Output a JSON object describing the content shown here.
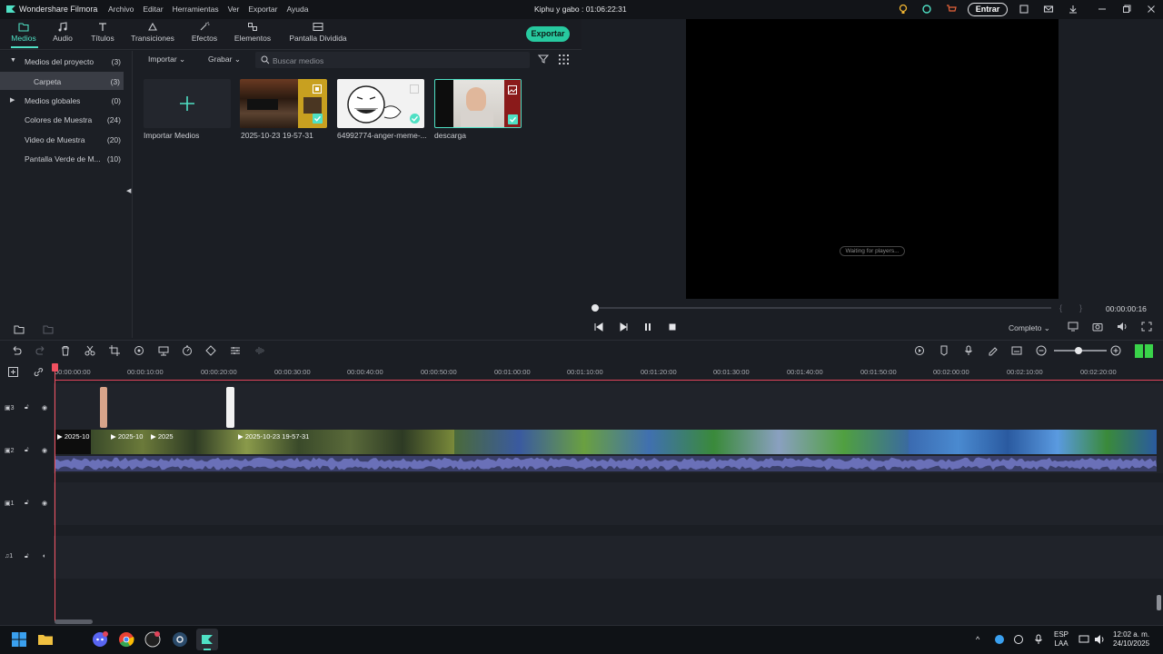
{
  "app": {
    "name": "Wondershare Filmora",
    "project_title": "Kiphu y gabo : 01:06:22:31",
    "login_label": "Entrar"
  },
  "menu": [
    "Archivo",
    "Editar",
    "Herramientas",
    "Ver",
    "Exportar",
    "Ayuda"
  ],
  "tabs": [
    {
      "label": "Medios",
      "icon": "folder-icon"
    },
    {
      "label": "Audio",
      "icon": "music-icon"
    },
    {
      "label": "Títulos",
      "icon": "text-icon"
    },
    {
      "label": "Transiciones",
      "icon": "transition-icon"
    },
    {
      "label": "Efectos",
      "icon": "effects-icon"
    },
    {
      "label": "Elementos",
      "icon": "elements-icon"
    },
    {
      "label": "Pantalla Dividida",
      "icon": "split-screen-icon"
    }
  ],
  "export_label": "Exportar",
  "sidebar": {
    "items": [
      {
        "label": "Medios del proyecto",
        "count": "(3)"
      },
      {
        "label": "Carpeta",
        "count": "(3)"
      },
      {
        "label": "Medios globales",
        "count": "(0)"
      },
      {
        "label": "Colores de Muestra",
        "count": "(24)"
      },
      {
        "label": "Video de Muestra",
        "count": "(20)"
      },
      {
        "label": "Pantalla Verde de M...",
        "count": "(10)"
      }
    ]
  },
  "media": {
    "import_dropdown": "Importar",
    "record_dropdown": "Grabar",
    "search_placeholder": "Buscar medios",
    "import_media_label": "Importar Medios",
    "items": [
      {
        "label": "2025-10-23 19-57-31"
      },
      {
        "label": "64992774-anger-meme-..."
      },
      {
        "label": "descarga"
      }
    ]
  },
  "preview": {
    "waiting_text": "Waiting for players...",
    "timecode": "00:00:00:16",
    "quality": "Completo",
    "progress": 0
  },
  "timeline": {
    "ruler_labels": [
      "00:00:00:00",
      "00:00:10:00",
      "00:00:20:00",
      "00:00:30:00",
      "00:00:40:00",
      "00:00:50:00",
      "00:01:00:00",
      "00:01:10:00",
      "00:01:20:00",
      "00:01:30:00",
      "00:01:40:00",
      "00:01:50:00",
      "00:02:00:00",
      "00:02:10:00",
      "00:02:20:00"
    ],
    "tracks": [
      {
        "num": "3"
      },
      {
        "num": "2"
      },
      {
        "num": "1"
      },
      {
        "num": "1"
      }
    ],
    "clip_labels": [
      "2025-10",
      "2025-10",
      "2025",
      "2025-10-23 19-57-31"
    ]
  },
  "taskbar": {
    "lang": "ESP",
    "lang_sub": "LAA",
    "time": "12:02 a. m.",
    "date": "24/10/2025"
  },
  "colors": {
    "accent": "#4fe0c4",
    "export": "#27c99f",
    "playhead": "#f05060"
  }
}
